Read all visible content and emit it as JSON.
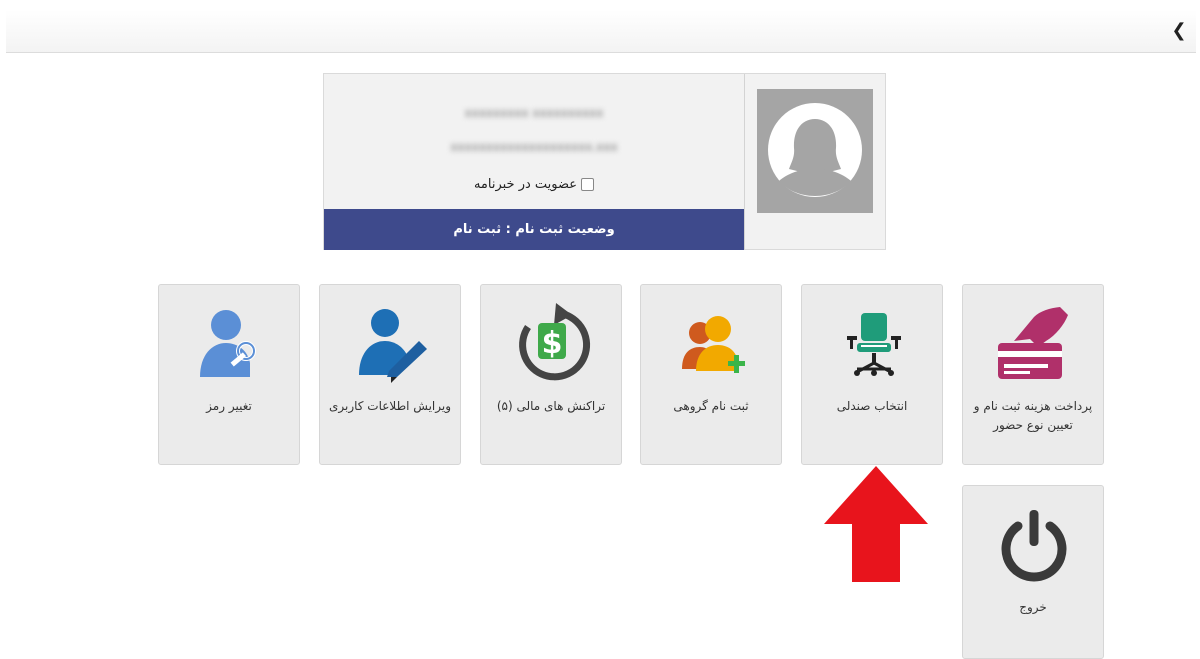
{
  "header": {
    "back_icon": "chevron-left-icon"
  },
  "profile": {
    "name_blurred": "xxxxxxxxx xxxxxxxxxx",
    "email_blurred": "xxxxxxxxxxxxxxxxxxxx.xxx",
    "newsletter_label": "عضویت در خبرنامه",
    "newsletter_checked": false,
    "status": "وضعیت ثبت نام : ثبت نام",
    "avatar_icon": "user-silhouette-icon",
    "status_color": "#3e4a8c"
  },
  "tiles": [
    {
      "id": "payment",
      "label": "پرداخت هزینه ثبت نام و تعیین نوع حضور",
      "icon": "payment-card-icon"
    },
    {
      "id": "seat",
      "label": "انتخاب صندلی",
      "icon": "chair-icon"
    },
    {
      "id": "group",
      "label": "ثبت نام گروهی",
      "icon": "group-add-icon"
    },
    {
      "id": "transactions",
      "label": "تراکنش های مالی (۵)",
      "icon": "dollar-refresh-icon"
    },
    {
      "id": "edit",
      "label": "ویرایش اطلاعات کاربری",
      "icon": "user-edit-icon"
    },
    {
      "id": "password",
      "label": "تغییر رمز",
      "icon": "user-key-icon"
    },
    {
      "id": "logout",
      "label": "خروج",
      "icon": "power-icon"
    }
  ],
  "annotation": {
    "icon": "red-arrow-up-icon",
    "color": "#e8141c"
  }
}
